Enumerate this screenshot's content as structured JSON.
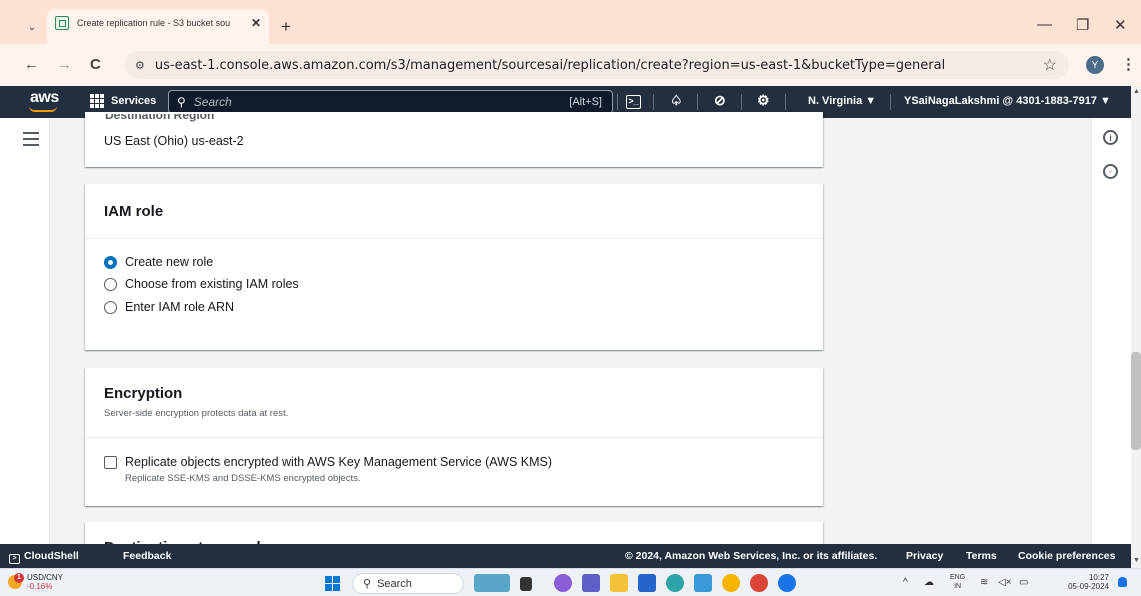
{
  "browser": {
    "tab_title": "Create replication rule - S3 bucket sou",
    "tab_close": "✕",
    "new_tab": "+",
    "url": "us-east-1.console.aws.amazon.com/s3/management/sourcesai/replication/create?region=us-east-1&bucketType=general",
    "profile_initial": "Y",
    "nav": {
      "back": "←",
      "forward": "→",
      "reload": "C",
      "star": "☆",
      "menu": "⋮",
      "site_info": "⚙"
    },
    "window": {
      "minimize": "—",
      "maximize": "❐",
      "close": "✕"
    },
    "tab_menu": "⌄"
  },
  "aws_nav": {
    "logo": "aws",
    "services": "Services",
    "search_placeholder": "Search",
    "search_shortcut": "[Alt+S]",
    "region": "N. Virginia ▼",
    "account": "YSaiNagaLakshmi @ 4301-1883-7917 ▼",
    "icons": [
      "cloudshell-icon",
      "notifications-icon",
      "help-icon",
      "settings-icon"
    ]
  },
  "destination": {
    "label": "Destination Region",
    "value": "US East (Ohio) us-east-2"
  },
  "iam_role": {
    "title": "IAM role",
    "options": [
      {
        "label": "Create new role",
        "checked": true
      },
      {
        "label": "Choose from existing IAM roles",
        "checked": false
      },
      {
        "label": "Enter IAM role ARN",
        "checked": false
      }
    ]
  },
  "encryption": {
    "title": "Encryption",
    "description": "Server-side encryption protects data at rest.",
    "checkbox_label": "Replicate objects encrypted with AWS Key Management Service (AWS KMS)",
    "checkbox_desc": "Replicate SSE-KMS and DSSE-KMS encrypted objects.",
    "checked": false
  },
  "next_section": {
    "title": "Destination storage class"
  },
  "footer": {
    "cloudshell": "CloudShell",
    "feedback": "Feedback",
    "copyright": "© 2024, Amazon Web Services, Inc. or its affiliates.",
    "privacy": "Privacy",
    "terms": "Terms",
    "cookie": "Cookie preferences"
  },
  "taskbar": {
    "weather_badge": "1",
    "ticker_name": "USD/CNY",
    "ticker_change": "-0.16%",
    "search": "Search",
    "lang_top": "ENG",
    "lang_bottom": "IN",
    "time": "10:27",
    "date": "05-09-2024"
  },
  "colors": {
    "aws_nav_bg": "#232f3e",
    "radio_selected": "#0073bb",
    "tabstrip_bg": "#fde2d4"
  }
}
